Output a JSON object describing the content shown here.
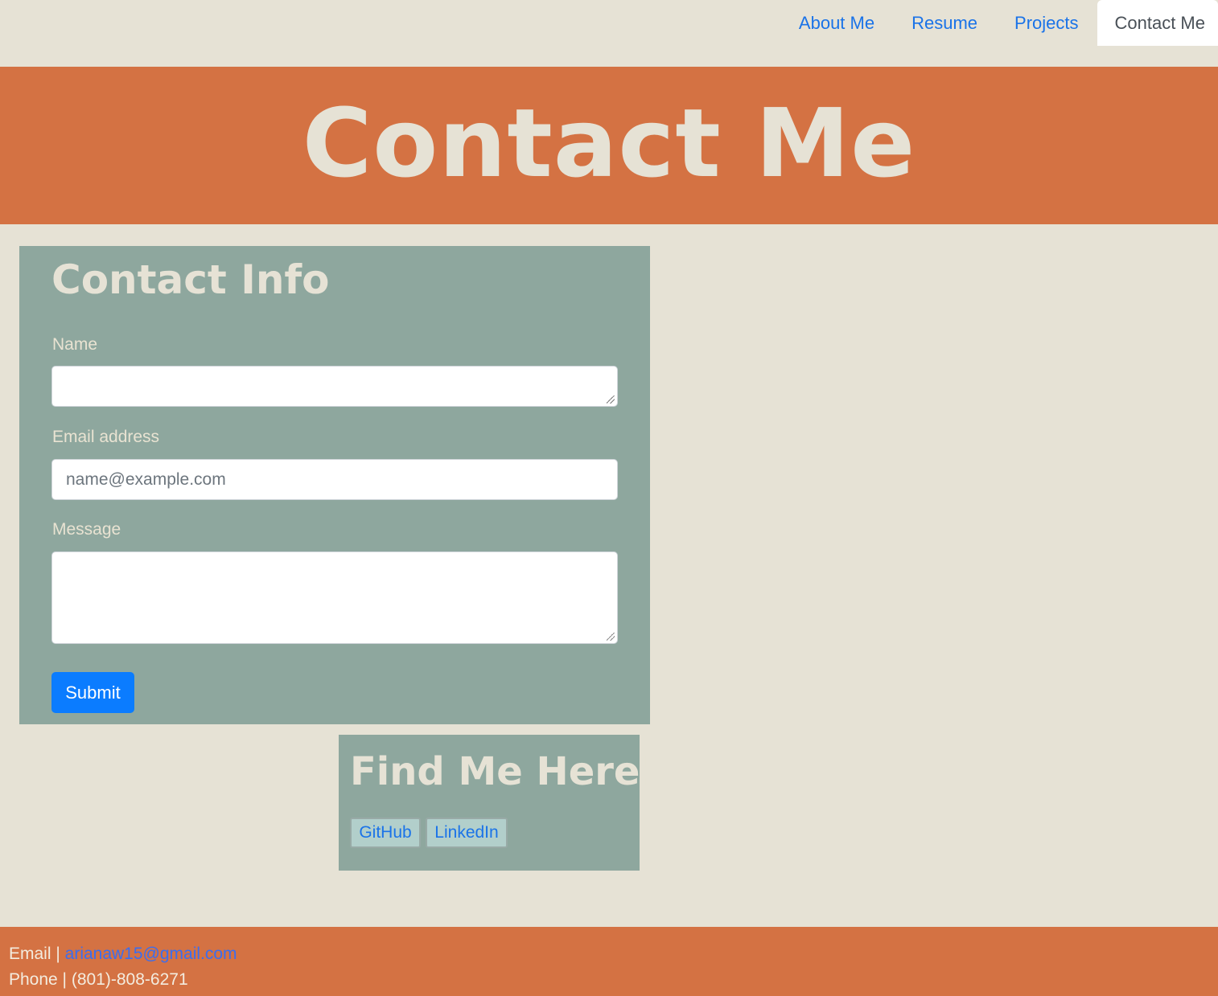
{
  "nav": {
    "items": [
      {
        "label": "About Me"
      },
      {
        "label": "Resume"
      },
      {
        "label": "Projects"
      },
      {
        "label": "Contact Me",
        "active": true
      }
    ]
  },
  "hero": {
    "title": "Contact Me"
  },
  "contact_form": {
    "title": "Contact Info",
    "name_label": "Name",
    "name_value": "",
    "email_label": "Email address",
    "email_placeholder": "name@example.com",
    "message_label": "Message",
    "message_value": "",
    "submit_label": "Submit"
  },
  "find_me": {
    "title": "Find Me Here!",
    "github_label": "GitHub",
    "linkedin_label": "LinkedIn"
  },
  "footer": {
    "email_prefix": "Email | ",
    "email": "arianaw15@gmail.com",
    "phone_prefix": "Phone | ",
    "phone": "(801)-808-6271"
  },
  "colors": {
    "background": "#e6e2d5",
    "accent": "#d47243",
    "card": "#8ea79e",
    "link": "#1a73e8",
    "primary_button": "#0b7cff"
  }
}
